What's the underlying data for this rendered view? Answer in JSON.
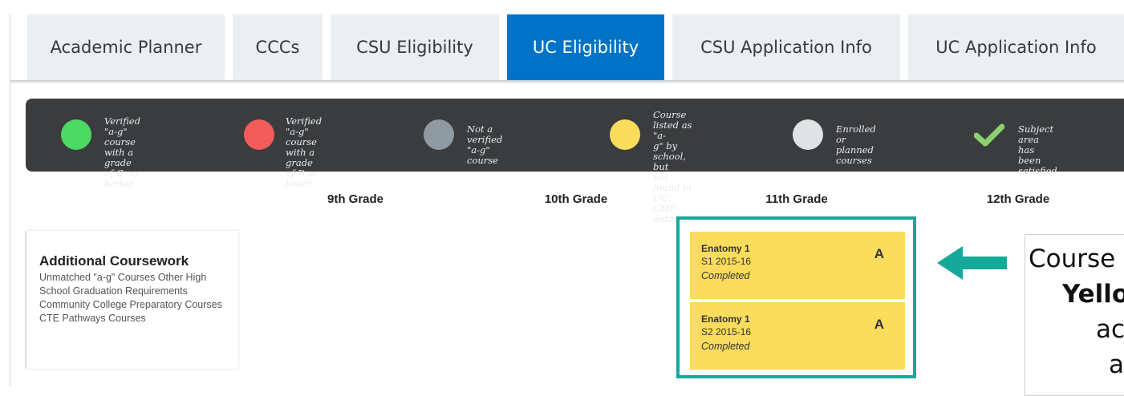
{
  "tabs": [
    {
      "label": "Academic Planner"
    },
    {
      "label": "CCCs"
    },
    {
      "label": "CSU Eligibility"
    },
    {
      "label": "UC Eligibility",
      "active": true
    },
    {
      "label": "CSU Application Info"
    },
    {
      "label": "UC Application Info"
    }
  ],
  "legend": [
    {
      "icon": "green-circle-icon",
      "color": "#4cd964",
      "text_lines": [
        "Verified \"a-g\"",
        "course with a grade",
        "of C- or better"
      ]
    },
    {
      "icon": "red-circle-icon",
      "color": "#f45b5b",
      "text_lines": [
        "Verified \"a-g\"",
        "course with a grade",
        "of D or lower"
      ]
    },
    {
      "icon": "gray-circle-icon",
      "color": "#8e9ba2",
      "text_lines": [
        "Not a verified \"a-g\"",
        "course"
      ]
    },
    {
      "icon": "yellow-circle-icon",
      "color": "#fbdc5d",
      "text_lines": [
        "Course listed as \"a-",
        "g\" by school, but",
        "not found in UC",
        "CMP database"
      ]
    },
    {
      "icon": "light-gray-circle-icon",
      "color": "#dfe3e6",
      "text_lines": [
        "Enrolled or planned",
        "courses"
      ]
    },
    {
      "icon": "checkmark-icon",
      "color": "#8ccf71",
      "text_lines": [
        "Subject area has",
        "been satisfied"
      ]
    }
  ],
  "grades": [
    "9th Grade",
    "10th Grade",
    "11th Grade",
    "12th Grade"
  ],
  "additional": {
    "title": "Additional Coursework",
    "description": "Unmatched \"a-g\" Courses Other High School Graduation Requirements Community College Preparatory Courses CTE Pathways Courses"
  },
  "courses": [
    {
      "name": "Enatomy 1",
      "term": "S1 2015-16",
      "status": "Completed",
      "grade": "A"
    },
    {
      "name": "Enatomy 1",
      "term": "S2 2015-16",
      "status": "Completed",
      "grade": "A"
    }
  ],
  "callout": {
    "lines": [
      "Course",
      "Yello",
      "ac",
      "a"
    ]
  },
  "colors": {
    "accent": "#0073c7",
    "highlight": "#16a89a",
    "course_yellow": "#fbdc5d",
    "legend_bg": "#3b3c3d"
  }
}
